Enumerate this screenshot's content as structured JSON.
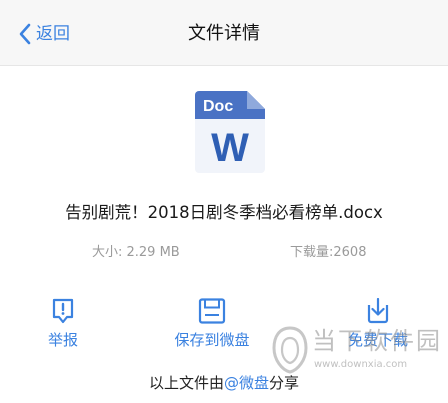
{
  "header": {
    "back_label": "返回",
    "title": "文件详情"
  },
  "file": {
    "icon_label": "Doc",
    "icon_letter": "W",
    "name": "告别剧荒！2018日剧冬季档必看榜单.docx",
    "size": "大小: 2.29 MB",
    "downloads": "下载量:2608"
  },
  "actions": [
    {
      "label": "举报",
      "icon": "report-icon"
    },
    {
      "label": "保存到微盘",
      "icon": "save-disk-icon"
    },
    {
      "label": "免费下载",
      "icon": "download-icon"
    }
  ],
  "footer": {
    "prefix": "以上文件由",
    "link": "@微盘",
    "suffix": "分享"
  },
  "watermark": {
    "text": "当下软件园",
    "url": "www.downxia.com"
  },
  "colors": {
    "accent": "#3b82e0",
    "doc_header": "#4a72c4",
    "doc_letter": "#2f5fb4"
  }
}
